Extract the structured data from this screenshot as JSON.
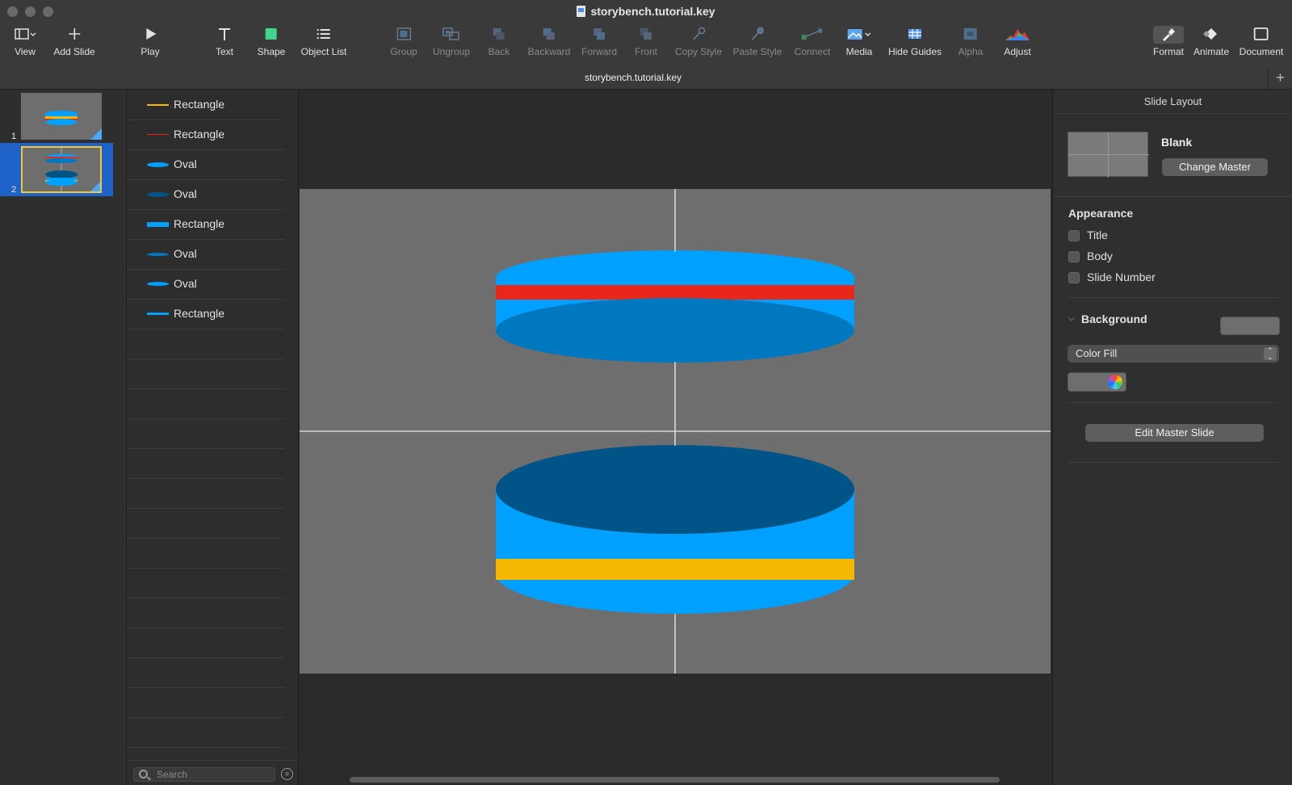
{
  "window": {
    "title": "storybench.tutorial.key",
    "tab_title": "storybench.tutorial.key",
    "tab_add": "+"
  },
  "toolbar": {
    "items": [
      {
        "label": "View",
        "icon": "view-sidebar-icon",
        "enabled": true
      },
      {
        "label": "Add Slide",
        "icon": "plus-icon",
        "enabled": true
      },
      {
        "label": "Play",
        "icon": "play-icon",
        "enabled": true
      },
      {
        "label": "Text",
        "icon": "text-icon",
        "enabled": true
      },
      {
        "label": "Shape",
        "icon": "shape-icon",
        "enabled": true
      },
      {
        "label": "Object List",
        "icon": "list-icon",
        "enabled": true
      },
      {
        "label": "Group",
        "icon": "group-icon",
        "enabled": false
      },
      {
        "label": "Ungroup",
        "icon": "ungroup-icon",
        "enabled": false
      },
      {
        "label": "Back",
        "icon": "back-icon",
        "enabled": false
      },
      {
        "label": "Backward",
        "icon": "backward-icon",
        "enabled": false
      },
      {
        "label": "Forward",
        "icon": "forward-icon",
        "enabled": false
      },
      {
        "label": "Front",
        "icon": "front-icon",
        "enabled": false
      },
      {
        "label": "Copy Style",
        "icon": "copy-style-icon",
        "enabled": false
      },
      {
        "label": "Paste Style",
        "icon": "paste-style-icon",
        "enabled": false
      },
      {
        "label": "Connect",
        "icon": "connect-icon",
        "enabled": false
      },
      {
        "label": "Media",
        "icon": "media-icon",
        "enabled": true
      },
      {
        "label": "Hide Guides",
        "icon": "guides-icon",
        "enabled": true
      },
      {
        "label": "Alpha",
        "icon": "alpha-icon",
        "enabled": false
      },
      {
        "label": "Adjust",
        "icon": "adjust-icon",
        "enabled": true
      },
      {
        "label": "Format",
        "icon": "format-brush-icon",
        "enabled": true
      },
      {
        "label": "Animate",
        "icon": "animate-diamond-icon",
        "enabled": true
      },
      {
        "label": "Document",
        "icon": "document-icon",
        "enabled": true
      }
    ]
  },
  "navigator": {
    "slides": [
      {
        "number": "1",
        "selected": false
      },
      {
        "number": "2",
        "selected": true
      }
    ]
  },
  "object_list": {
    "items": [
      {
        "label": "Rectangle",
        "color": "#f5b800"
      },
      {
        "label": "Rectangle",
        "color": "#e8261a"
      },
      {
        "label": "Oval",
        "color": "#00a0ff"
      },
      {
        "label": "Oval",
        "color": "#005488"
      },
      {
        "label": "Rectangle",
        "color": "#00a0ff"
      },
      {
        "label": "Oval",
        "color": "#0078c0"
      },
      {
        "label": "Oval",
        "color": "#00a0ff"
      },
      {
        "label": "Rectangle",
        "color": "#00a0ff"
      }
    ],
    "search_placeholder": "Search"
  },
  "inspector": {
    "header": "Slide Layout",
    "master_name": "Blank",
    "change_master_label": "Change Master",
    "appearance_title": "Appearance",
    "appearance_options": [
      {
        "label": "Title",
        "checked": false
      },
      {
        "label": "Body",
        "checked": false
      },
      {
        "label": "Slide Number",
        "checked": false
      }
    ],
    "background_title": "Background",
    "fill_type": "Color Fill",
    "edit_master_label": "Edit Master Slide"
  },
  "colors": {
    "light_blue": "#00a0ff",
    "mid_blue": "#0078c0",
    "dark_blue": "#005488",
    "red": "#e8261a",
    "yellow": "#f5b800",
    "slide_bg": "#6e6e6e",
    "selection": "#1f63c9"
  }
}
